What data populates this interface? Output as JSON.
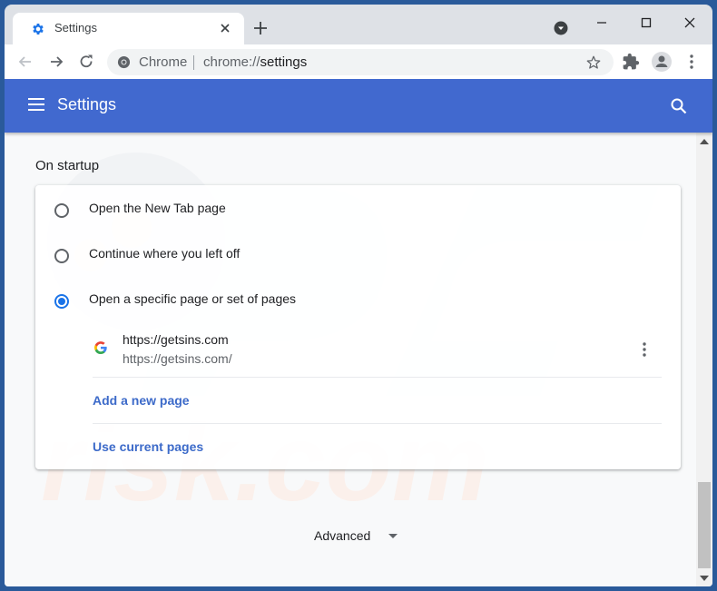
{
  "tab": {
    "title": "Settings",
    "favicon": "gear-icon"
  },
  "toolbar": {
    "chip": "Chrome",
    "url_scheme": "chrome://",
    "url_host": "settings"
  },
  "header": {
    "title": "Settings"
  },
  "startup": {
    "section_title": "On startup",
    "options": [
      {
        "label": "Open the New Tab page",
        "checked": false
      },
      {
        "label": "Continue where you left off",
        "checked": false
      },
      {
        "label": "Open a specific page or set of pages",
        "checked": true
      }
    ],
    "pages": [
      {
        "name": "https://getsins.com",
        "url": "https://getsins.com/"
      }
    ],
    "add_page_label": "Add a new page",
    "use_current_label": "Use current pages"
  },
  "advanced": {
    "label": "Advanced"
  },
  "colors": {
    "header": "#4169cf",
    "link": "#3c6ac9",
    "radio_checked": "#1a73e8"
  }
}
